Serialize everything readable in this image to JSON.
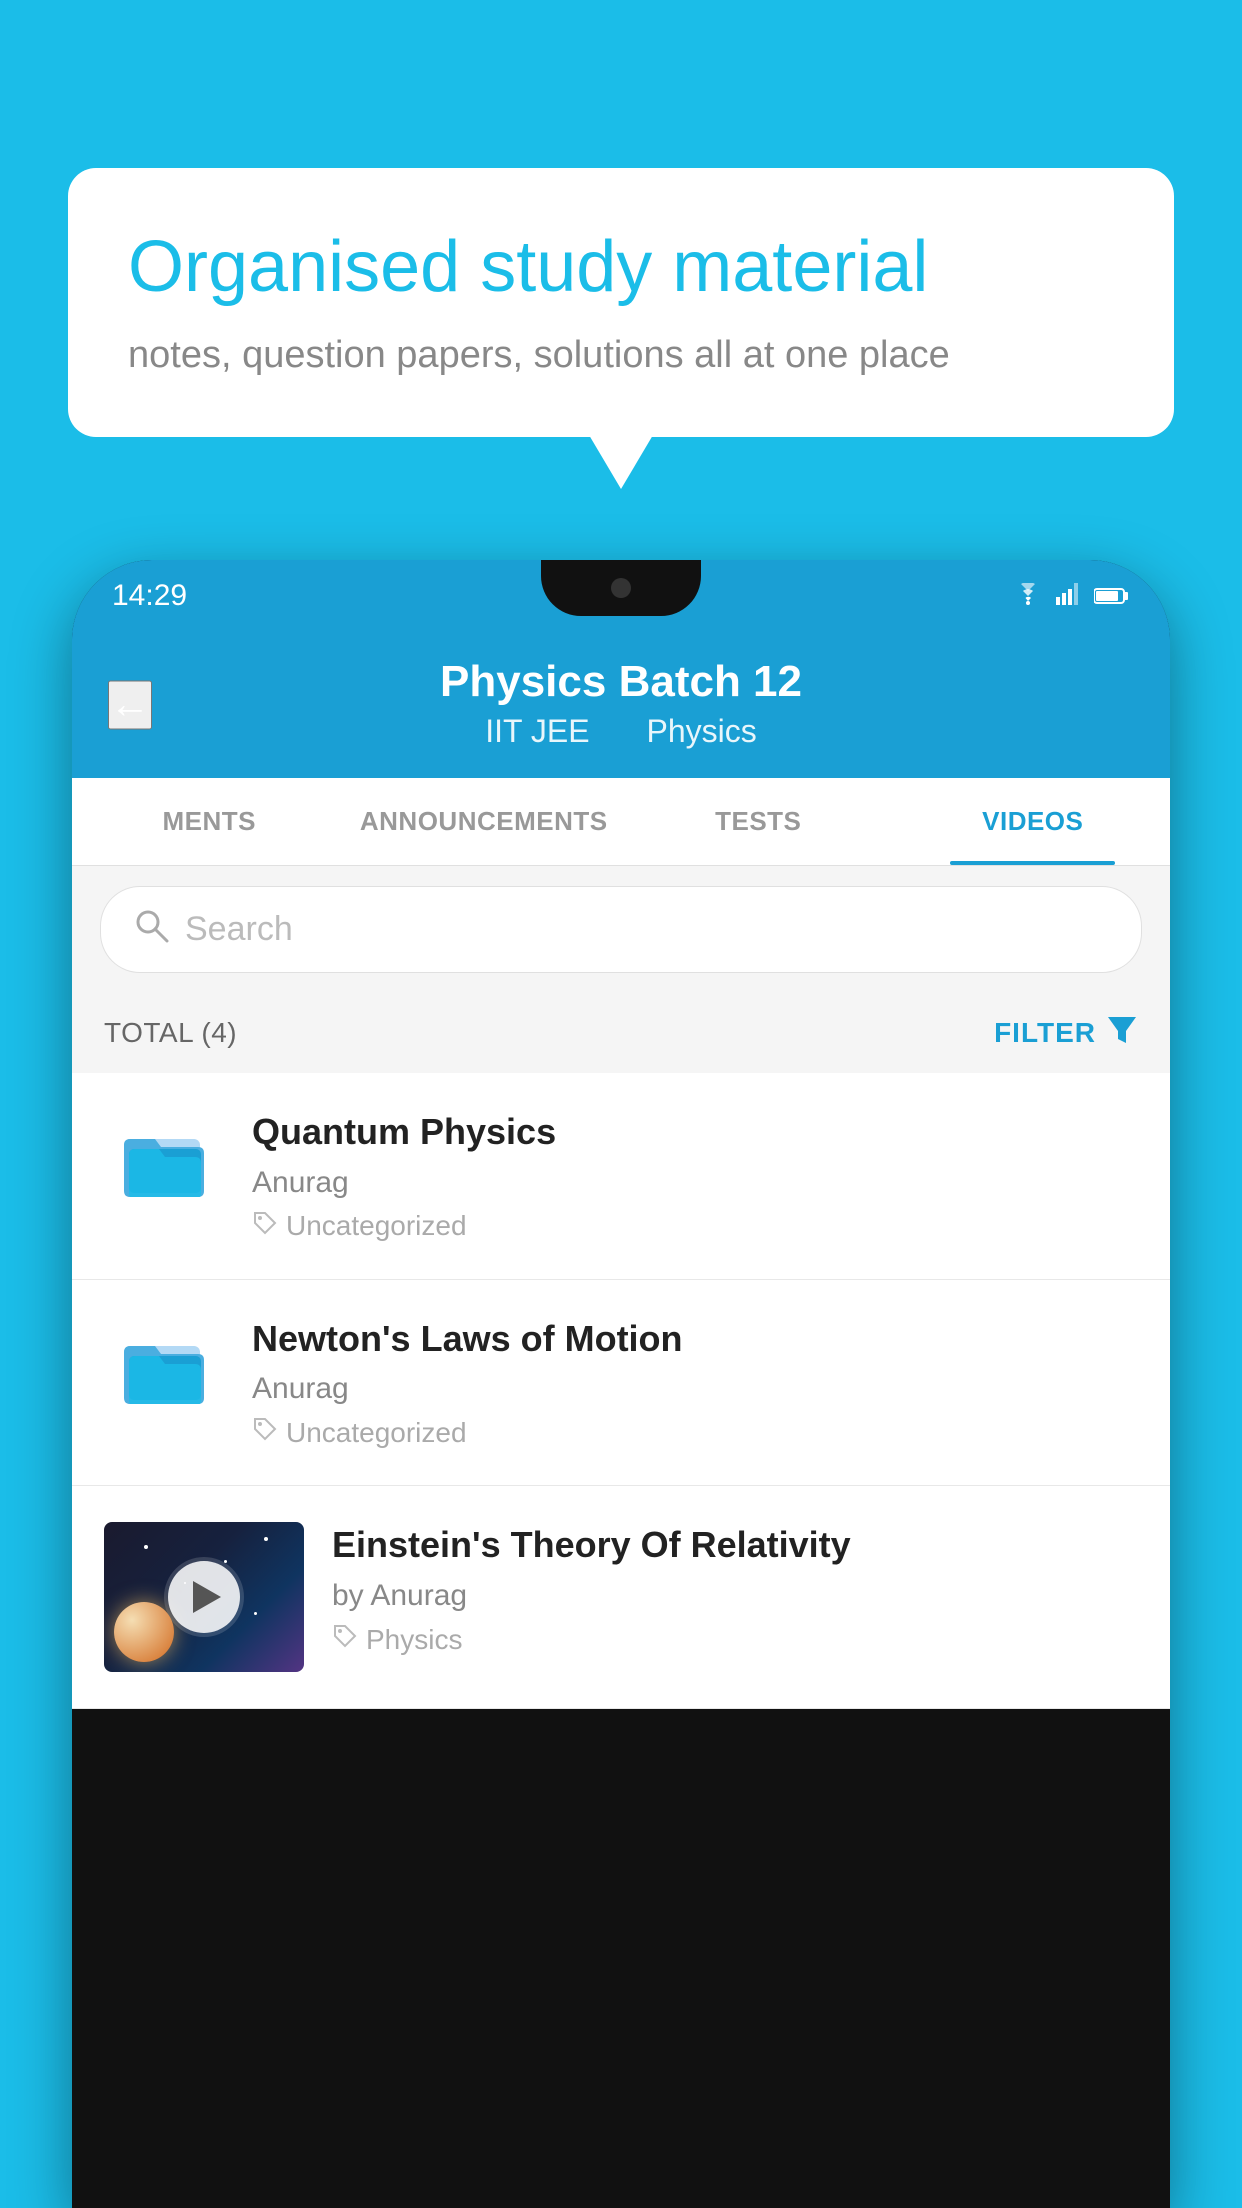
{
  "background_color": "#1bbde8",
  "bubble": {
    "title": "Organised study material",
    "subtitle": "notes, question papers, solutions all at one place"
  },
  "status_bar": {
    "time": "14:29",
    "wifi": "▼",
    "signal": "▲",
    "battery": "▐"
  },
  "header": {
    "title": "Physics Batch 12",
    "subtitle_1": "IIT JEE",
    "subtitle_2": "Physics",
    "back_arrow": "←"
  },
  "tabs": [
    {
      "label": "MENTS",
      "active": false
    },
    {
      "label": "ANNOUNCEMENTS",
      "active": false
    },
    {
      "label": "TESTS",
      "active": false
    },
    {
      "label": "VIDEOS",
      "active": true
    }
  ],
  "search": {
    "placeholder": "Search"
  },
  "filter_row": {
    "total": "TOTAL (4)",
    "filter_label": "FILTER"
  },
  "videos": [
    {
      "id": 1,
      "title": "Quantum Physics",
      "author": "Anurag",
      "tag": "Uncategorized",
      "type": "folder"
    },
    {
      "id": 2,
      "title": "Newton's Laws of Motion",
      "author": "Anurag",
      "tag": "Uncategorized",
      "type": "folder"
    },
    {
      "id": 3,
      "title": "Einstein's Theory Of Relativity",
      "author": "by Anurag",
      "tag": "Physics",
      "type": "video"
    }
  ]
}
